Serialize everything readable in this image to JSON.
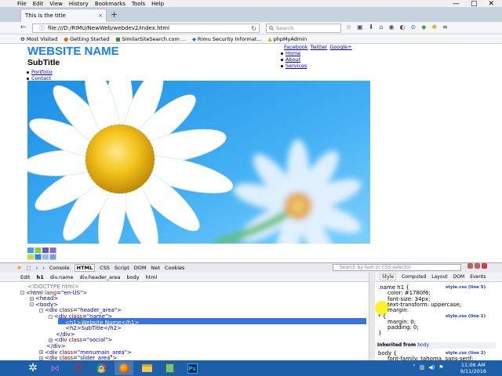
{
  "menu": [
    "File",
    "Edit",
    "View",
    "History",
    "Bookmarks",
    "Tools",
    "Help"
  ],
  "window_controls": [
    "—",
    "□",
    "✕"
  ],
  "tab": {
    "title": "This is the title",
    "close": "×",
    "new": "+"
  },
  "nav": {
    "back": "←",
    "info": "ⓘ",
    "url": "file:///D:/RIMU/NewWeb/webdev2/index.html",
    "reload": "↻",
    "search_placeholder": "Search"
  },
  "bookmarks": [
    "Most Visited",
    "Getting Started",
    "SimilarSiteSearch.com ...",
    "Rimu Security Informat...",
    "phpMyAdmin"
  ],
  "page": {
    "site_name": "WEBSITE NAME",
    "subtitle": "SubTitle",
    "left_nav": [
      "Portfolio",
      "Contact"
    ],
    "social": [
      "Facebook",
      "Twitter",
      "Google+"
    ],
    "right_nav": [
      "Home",
      "About",
      "Services"
    ],
    "thumb_colors": [
      "#3aa6e0",
      "#8fc84c",
      "#5b5fc8",
      "#8a6ad0",
      "#c8d84c",
      "#2e8ad0",
      "#a0b8d8",
      "#6fa0e0"
    ]
  },
  "firebug": {
    "tabs": [
      "Console",
      "HTML",
      "CSS",
      "Script",
      "DOM",
      "Net",
      "Cookies"
    ],
    "selected_tab": "HTML",
    "search_placeholder": "Search by text or CSS selector",
    "crumbs": [
      "Edit",
      "h1",
      "div.name",
      "div.header_area",
      "body",
      "html"
    ],
    "html_lines": [
      {
        "indent": 0,
        "toggle": "",
        "tag": "<!DOCTYPE html>"
      },
      {
        "indent": 0,
        "toggle": "-",
        "tag": "<html",
        "attr": "lang",
        "val": "\"en-US\"",
        "end": ">"
      },
      {
        "indent": 1,
        "toggle": "+",
        "tag": "<head>"
      },
      {
        "indent": 1,
        "toggle": "-",
        "tag": "<body>"
      },
      {
        "indent": 2,
        "toggle": "-",
        "tag": "<div",
        "attr": "class",
        "val": "\"header_area\"",
        "end": ">"
      },
      {
        "indent": 3,
        "toggle": "-",
        "tag": "<div",
        "attr": "class",
        "val": "\"name\"",
        "end": ">"
      },
      {
        "indent": 4,
        "toggle": "",
        "tag": "<h1>Website Name</h1>"
      },
      {
        "indent": 4,
        "toggle": "",
        "tag": "<h2>SubTitle</h2>"
      },
      {
        "indent": 3,
        "toggle": "",
        "tag": "</div>"
      },
      {
        "indent": 3,
        "toggle": "+",
        "tag": "<div",
        "attr": "class",
        "val": "\"social\"",
        "end": ">"
      },
      {
        "indent": 2,
        "toggle": "",
        "tag": "</div>"
      },
      {
        "indent": 2,
        "toggle": "+",
        "tag": "<div",
        "attr": "class",
        "val": "\"menumain_area\"",
        "end": ">"
      },
      {
        "indent": 2,
        "toggle": "+",
        "tag": "<div",
        "attr": "class",
        "val": "\"slider_area\"",
        "end": ">"
      }
    ],
    "side_tabs": [
      "Style",
      "Computed",
      "Layout",
      "DOM",
      "Events"
    ],
    "style_rules": [
      {
        "sel": ".name h1 {",
        "src": "style.css (line 5)"
      },
      {
        "prop": "color: #1780f6;"
      },
      {
        "prop": "font-size: 34px;"
      },
      {
        "prop": "text-transform: uppercase;"
      },
      {
        "prop": "margin:"
      },
      {
        "sel": "* {",
        "src": "style.css (line 1)"
      },
      {
        "prop": "margin: 0;"
      },
      {
        "prop": "padding: 0;"
      },
      {
        "sel": "}"
      }
    ],
    "inherited_label": "Inherited from",
    "inherited_link": "body",
    "body_rule": {
      "sel": "body {",
      "src": "style.css (line 2)",
      "prop": "font-family: tahoma, sans-serif;"
    }
  },
  "taskbar": {
    "time": "11:06 AM",
    "date": "9/11/2016",
    "icons": [
      "start",
      "visual-studio",
      "opera",
      "chrome",
      "firefox",
      "file-explorer",
      "notepad",
      "photoshop"
    ],
    "ps_label": "Ps"
  }
}
